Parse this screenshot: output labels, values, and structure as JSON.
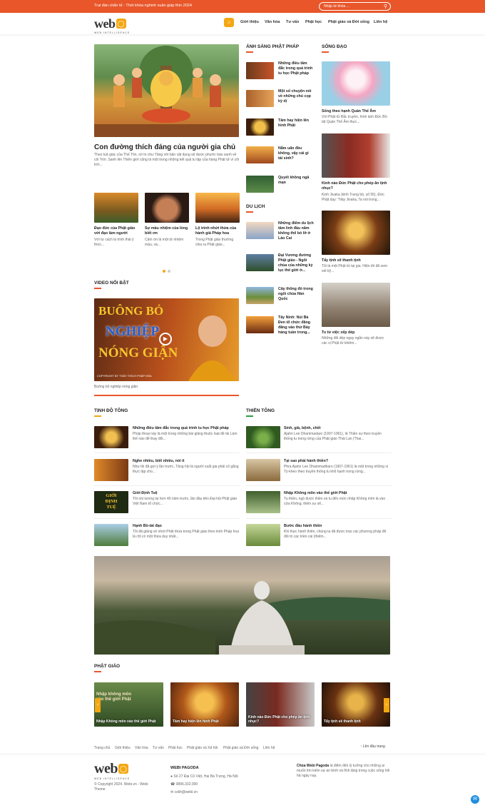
{
  "topbar": {
    "promo": "Trai đàn chẩn tế - Thời khóa nghinh xuân giáp thìn 2024",
    "search_placeholder": "Nhập từ khóa ..."
  },
  "header": {
    "logo_text": "web",
    "logo_sub": "WEB INTELLIGENCE",
    "nav": [
      "Giới thiệu",
      "Văn hóa",
      "Tư vấn",
      "Phật học",
      "Phật giáo và Đời sống",
      "Liên hệ"
    ]
  },
  "hero": {
    "title": "Con đường thích đáng của người gia chủ",
    "excerpt": "Theo tuệ giác của Thế Tôn, nó tri chư Tăng với bản vật dụng sẽ được phước báo sanh về cõi Trời. Sanh lên Thiên giới cũng là một trong những kết quả tu tập của hàng Phật tử vì cõi trời..."
  },
  "small_posts": [
    {
      "title": "Đạo đức của Phật giáo với đạo làm người",
      "excerpt": "Với tư cách là hình thái ý thức..."
    },
    {
      "title": "Sự mầu nhiệm của lòng biết ơn",
      "excerpt": "Cảm ơn là một từ nhiệm màu, và..."
    },
    {
      "title": "Lộ trình nhứt thừa của hành giả Pháp hoa",
      "excerpt": "Trong Phật giáo thường chia ra Phật giáo..."
    }
  ],
  "video": {
    "heading": "VIDEO NỔI BẬT",
    "line1": "BUÔNG BỎ",
    "line2": "NGHIỆP",
    "line3": "NÓNG GIẬN",
    "credit": "COPYRIGHT BY THẦY THÍCH PHÁP HÒA",
    "caption": "Buông bỏ nghiệp nóng giận"
  },
  "anh_sang": {
    "heading": "ÁNH SÁNG PHẬT PHÁP",
    "items": [
      "Những điều tâm đắc trong quá trình tu học Phật pháp",
      "Một số chuyện nói về những chú cọp kỳ dị",
      "Tâm hay hiện lên hình Phật",
      "Nằm uẩn đều không, vậy cái gì tái sinh?",
      "Quyết không ngã mạn"
    ]
  },
  "du_lich": {
    "heading": "DU LỊCH",
    "items": [
      "Những điểm du lịch tâm linh đầu năm không thể bỏ lỡ ở Lào Cai",
      "Đại Vương đường Phật giáo - Ngôi chùa của những kỷ lục thế giới ở...",
      "Cây thông đỏ trong ngôi chùa Hàn Quốc",
      "Tây Ninh: Núi Bà Đen tổ chức đăng đăng vào thứ Bảy hàng tuần trong..."
    ]
  },
  "song_dao": {
    "heading": "SỐNG ĐẠO",
    "items": [
      {
        "title": "Sống theo hạnh Quán Thế Âm",
        "excerpt": "Với Phật tử Bắc truyền, hình ảnh Đức Bồ-tát Quán Thế Âm thực..."
      },
      {
        "title": "Kinh nào Đức Phật cho phép ăn tịnh nhục?",
        "excerpt": "Kinh Jivaka (kinh Trung bộ, số 55), Đức Phật dạy: \"Này Jivaka, Ta nói trong..."
      },
      {
        "title": "Tẩy tịnh sẽ thanh tịnh",
        "excerpt": "Tôi là một Phật tử tại gia. Hiện tôi đã xem xét kỹ..."
      },
      {
        "title": "Tu từ việc xếp dép",
        "excerpt": "Những đôi dép ngay ngắn này sẽ được các vị Phật tử khiêm..."
      }
    ]
  },
  "tinh_do": {
    "heading": "TỊNH ĐỘ TÔNG",
    "items": [
      {
        "title": "Những điều tâm đắc trong quá trình tu học Phật pháp",
        "excerpt": "Pháp thoại này là một trong những bài giảng thuộc loạt đề tài Làm thế nào để thay đổi..."
      },
      {
        "title": "Nghe nhiều, biết nhiều, nói ít",
        "excerpt": "Như tôi đã gợi ý lần trước, Tăng hội là người xuất gia phải cố gắng thực tập cho..."
      },
      {
        "title": "Giới Định Tuệ",
        "excerpt": "Tôi nói tương lai hơn 40 năm trước, lần đầu tiên Đại hội Phật giáo Việt Nam tổ chức..."
      },
      {
        "title": "Hạnh Bồ-tát đạo",
        "excerpt": "Tôi đã giảng về nhứt Phật thừa trong Phật giáo theo kinh Pháp hoa là chỉ có một thừa duy nhất..."
      }
    ],
    "giao_words": [
      "GIỚI",
      "ĐỊNH",
      "TUỆ"
    ]
  },
  "thien_tong": {
    "heading": "THIỀN TÔNG",
    "items": [
      {
        "title": "Sinh, già, bệnh, chết",
        "excerpt": "Ajahn Lee Dhammadaro (1907-1961), là Thiền sư theo truyền thống tu trong rừng của Phật giáo Thái Lan (Thai..."
      },
      {
        "title": "Tại sao phải hành thiền?",
        "excerpt": "Phra Ajahn Lee Dhammadharo (1907-1961) là một trong những vị Tỳ-kheo theo truyền thống tu khổ hạnh trong rừng..."
      },
      {
        "title": "Nhập Không môn vào thế giới Phật",
        "excerpt": "Tu thiền, ngộ được thiền và tu đến mức nhập Không môn là vào cửa Không, thiền sư sẽ..."
      },
      {
        "title": "Bước đầu hành thiền",
        "excerpt": "Khi thực hành thiền, chúng ta đã được trao các phương pháp để đối trị các triền cái (thiếm..."
      }
    ]
  },
  "phat_giao": {
    "heading": "PHẬT GIÁO",
    "slides": [
      "Nhập Không môn vào thế giới Phật",
      "Tâm hay hiện lên hình Phật",
      "Kinh nào Đức Phật cho phép ăn tịnh nhục?",
      "Tẩy tịnh sẽ thanh tịnh"
    ],
    "overlay_text": "Nhập không môn vào thế giới Phật"
  },
  "footer": {
    "links": [
      "Trang chủ",
      "Giới thiệu",
      "Văn hóa",
      "Tư vấn",
      "Phật học",
      "Phật giáo và Xã hội",
      "Phật giáo và Đời sống",
      "Liên hệ"
    ],
    "top_link": "Lên đầu trang",
    "copyright": "© Copyright 2024. Webi.vn - Webi Theme",
    "org": "WEBI PAGODA",
    "address": "Số 27 Đại Cồ Việt, Hai Bà Trưng, Hà Nội",
    "phone": "0896.332.000",
    "email": "cskh@webi.vn",
    "about_name": "Chùa Webi Pagoda",
    "about_text": "là điểm đến lý tưởng cho những ai muốn tìm kiếm sự an bình và tĩnh lặng trong cuộc sống hối hả ngày nay."
  },
  "colors": {
    "accent": "#e8562a",
    "gold": "#f3a712",
    "green": "#2a9d45"
  }
}
